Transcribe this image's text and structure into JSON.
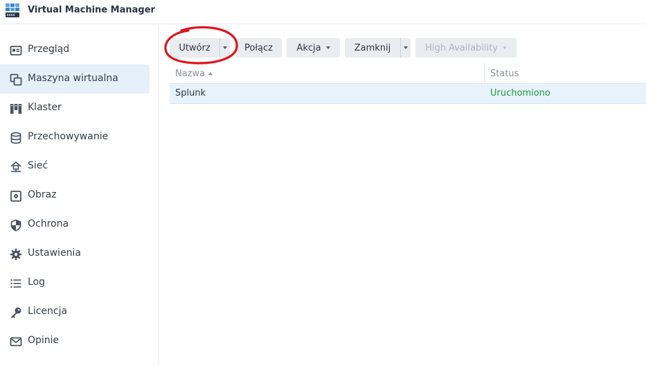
{
  "app": {
    "title": "Virtual Machine Manager"
  },
  "sidebar": {
    "items": [
      {
        "label": "Przegląd",
        "icon": "overview-icon",
        "active": false
      },
      {
        "label": "Maszyna wirtualna",
        "icon": "virtual-machine-icon",
        "active": true
      },
      {
        "label": "Klaster",
        "icon": "cluster-icon",
        "active": false
      },
      {
        "label": "Przechowywanie",
        "icon": "storage-icon",
        "active": false
      },
      {
        "label": "Sieć",
        "icon": "network-icon",
        "active": false
      },
      {
        "label": "Obraz",
        "icon": "image-icon",
        "active": false
      },
      {
        "label": "Ochrona",
        "icon": "shield-icon",
        "active": false
      },
      {
        "label": "Ustawienia",
        "icon": "gear-icon",
        "active": false
      },
      {
        "label": "Log",
        "icon": "log-list-icon",
        "active": false
      },
      {
        "label": "Licencja",
        "icon": "key-icon",
        "active": false
      },
      {
        "label": "Opinie",
        "icon": "mail-icon",
        "active": false
      }
    ]
  },
  "toolbar": {
    "create_label": "Utwórz",
    "connect_label": "Połącz",
    "action_label": "Akcja",
    "shutdown_label": "Zamknij",
    "ha_label": "High Availability"
  },
  "table": {
    "columns": [
      "Nazwa",
      "Status"
    ],
    "rows": [
      {
        "name": "Splunk",
        "status": "Uruchomiono"
      }
    ]
  },
  "colors": {
    "accent_selected": "#e6f0fa",
    "status_running": "#1d9a3a",
    "annotation": "#e0141e"
  }
}
